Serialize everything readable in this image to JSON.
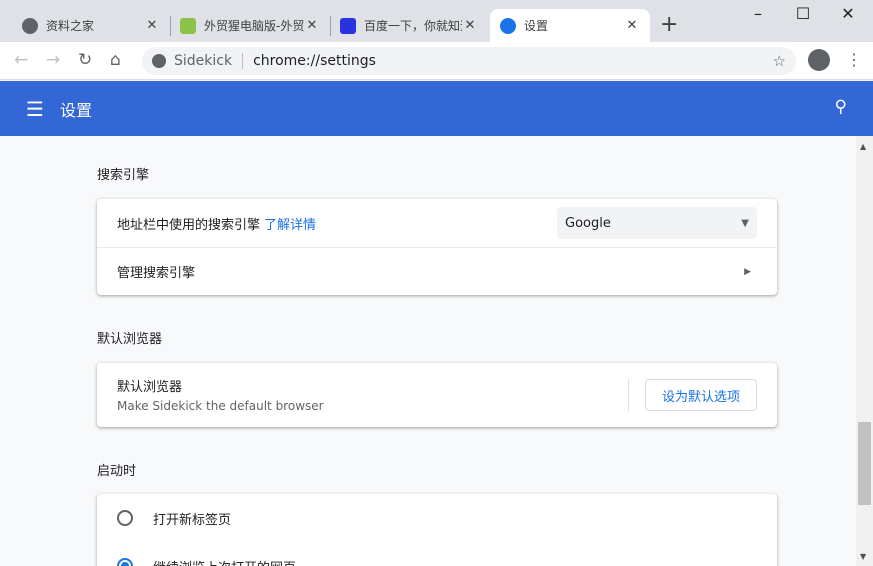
{
  "tabs": [
    {
      "title": "资料之家",
      "icon": "globe-icon",
      "color": "#5f6368"
    },
    {
      "title": "外贸猩电脑版-外贸",
      "icon": "app-icon",
      "color": "#8bc34a"
    },
    {
      "title": "百度一下，你就知道",
      "icon": "baidu-paw-icon",
      "color": "#2932e1"
    },
    {
      "title": "设置",
      "icon": "gear-icon",
      "color": "#1a73e8"
    }
  ],
  "address": {
    "site": "Sidekick",
    "url": "chrome://settings"
  },
  "header": {
    "title": "设置"
  },
  "search_engine": {
    "section": "搜索引擎",
    "label": "地址栏中使用的搜索引擎",
    "link": "了解详情",
    "selected": "Google",
    "manage": "管理搜索引擎"
  },
  "default_browser": {
    "section": "默认浏览器",
    "label": "默认浏览器",
    "sub": "Make Sidekick the default browser",
    "button": "设为默认选项"
  },
  "startup": {
    "section": "启动时",
    "options": [
      {
        "label": "打开新标签页",
        "checked": false
      },
      {
        "label": "继续浏览上次打开的网页",
        "checked": true
      }
    ]
  }
}
